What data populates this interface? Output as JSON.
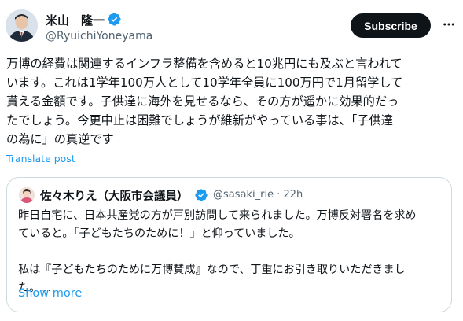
{
  "author": {
    "name": "米山　隆一",
    "handle": "@RyuichiYoneyama"
  },
  "actions": {
    "subscribe_label": "Subscribe"
  },
  "tweet": {
    "lines": [
      "万博の経費は関連するインフラ整備を含めると10兆円にも及ぶと言われて",
      "います。これは1学年100万人として10学年全員に100万円で1月留学して",
      "貰える金額です。子供達に海外を見せるなら、その方が遥かに効果的だっ",
      "たでしょう。今更中止は困難でしょうが維新がやっている事は、「子供達",
      "の為に」の真逆です"
    ],
    "translate_label": "Translate post"
  },
  "quote": {
    "name": "佐々木りえ（大阪市会議員）",
    "handle": "@sasaki_rie",
    "separator": "·",
    "time": "22h",
    "lines": [
      "昨日自宅に、日本共産党の方が戸別訪問して来られました。万博反対署名を求め",
      "ていると。「子どもたちのために！」と仰っていました。",
      "",
      "私は『子どもたちのために万博賛成』なので、丁重にお引き取りいただきまし",
      "た。…"
    ],
    "show_more_label": "Show more"
  },
  "colors": {
    "accent": "#1d9bf0",
    "text": "#0f1419",
    "secondary": "#536471",
    "border": "#cfd9de",
    "button_bg": "#0f1419"
  },
  "icons": {
    "verified": "verified-badge-icon",
    "more": "more-dots-icon"
  }
}
